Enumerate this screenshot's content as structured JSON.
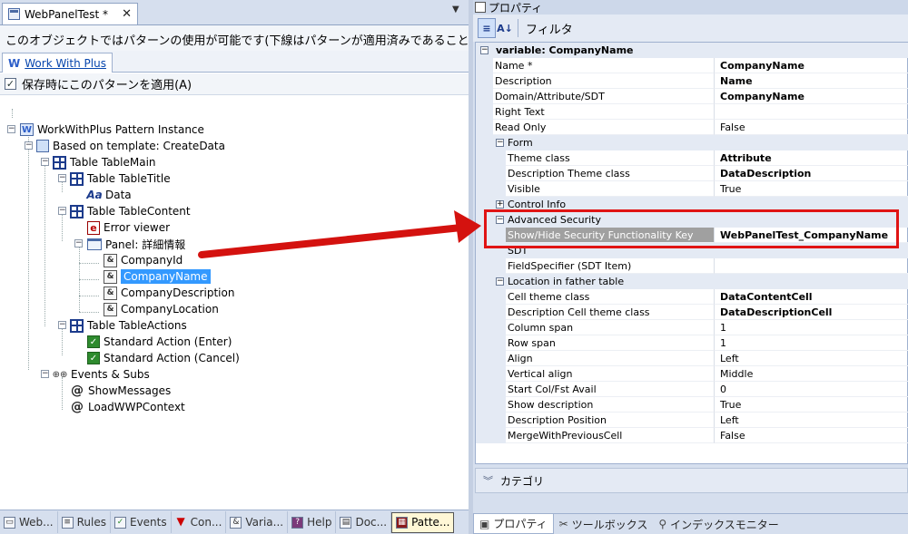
{
  "left": {
    "tab_title": "WebPanelTest *",
    "close_glyph": "✕",
    "info_text": "このオブジェクトではパターンの使用が可能です(下線はパターンが適用済みであることを示し",
    "pattern_tab": "Work With Plus",
    "apply_checkbox_label": "保存時にこのパターンを適用(A)",
    "apply_checked": true,
    "tree": {
      "root": "WorkWithPlus Pattern Instance",
      "template": "Based on template: CreateData",
      "table_main": "Table TableMain",
      "table_title": "Table TableTitle",
      "data": "Data",
      "table_content": "Table TableContent",
      "error_viewer": "Error viewer",
      "panel": "Panel: 詳細情報",
      "company_id": "CompanyId",
      "company_name": "CompanyName",
      "company_description": "CompanyDescription",
      "company_location": "CompanyLocation",
      "table_actions": "Table TableActions",
      "action_enter": "Standard Action (Enter)",
      "action_cancel": "Standard Action (Cancel)",
      "events_subs": "Events & Subs",
      "show_messages": "ShowMessages",
      "load_context": "LoadWWPContext"
    },
    "bottom_tabs": [
      "Web...",
      "Rules",
      "Events",
      "Con...",
      "Varia...",
      "Help",
      "Doc...",
      "Patte..."
    ]
  },
  "right": {
    "panel_title": "プロパティ",
    "filter_label": "フィルタ",
    "sort_category_icon": "≡",
    "sort_alpha_label": "A↓",
    "top_category": "variable: CompanyName",
    "rows": {
      "name_k": "Name *",
      "name_v": "CompanyName",
      "desc_k": "Description",
      "desc_v": "Name",
      "domain_k": "Domain/Attribute/SDT",
      "domain_v": "CompanyName",
      "righttext_k": "Right Text",
      "righttext_v": "",
      "readonly_k": "Read Only",
      "readonly_v": "False",
      "form_cat": "Form",
      "theme_k": "Theme class",
      "theme_v": "Attribute",
      "desctheme_k": "Description Theme class",
      "desctheme_v": "DataDescription",
      "visible_k": "Visible",
      "visible_v": "True",
      "controlinfo_cat": "Control Info",
      "advsec_cat": "Advanced Security",
      "showhide_k": "Show/Hide Security Functionality Key",
      "showhide_v": "WebPanelTest_CompanyName",
      "sdt_cat": "SDT",
      "fieldspec_k": "FieldSpecifier (SDT Item)",
      "fieldspec_v": "",
      "location_cat": "Location in father table",
      "celltheme_k": "Cell theme class",
      "celltheme_v": "DataContentCell",
      "desccelltheme_k": "Description Cell theme class",
      "desccelltheme_v": "DataDescriptionCell",
      "colspan_k": "Column span",
      "colspan_v": "1",
      "rowspan_k": "Row span",
      "rowspan_v": "1",
      "align_k": "Align",
      "align_v": "Left",
      "valign_k": "Vertical align",
      "valign_v": "Middle",
      "startcol_k": "Start Col/Fst Avail",
      "startcol_v": "0",
      "showdesc_k": "Show description",
      "showdesc_v": "True",
      "descpos_k": "Description Position",
      "descpos_v": "Left",
      "merge_k": "MergeWithPreviousCell",
      "merge_v": "False"
    },
    "category_bar": "カテゴリ",
    "bottom_tabs": [
      "プロパティ",
      "ツールボックス",
      "インデックスモニター"
    ]
  },
  "colors": {
    "highlight": "#e01414",
    "selection": "#3399ff"
  }
}
